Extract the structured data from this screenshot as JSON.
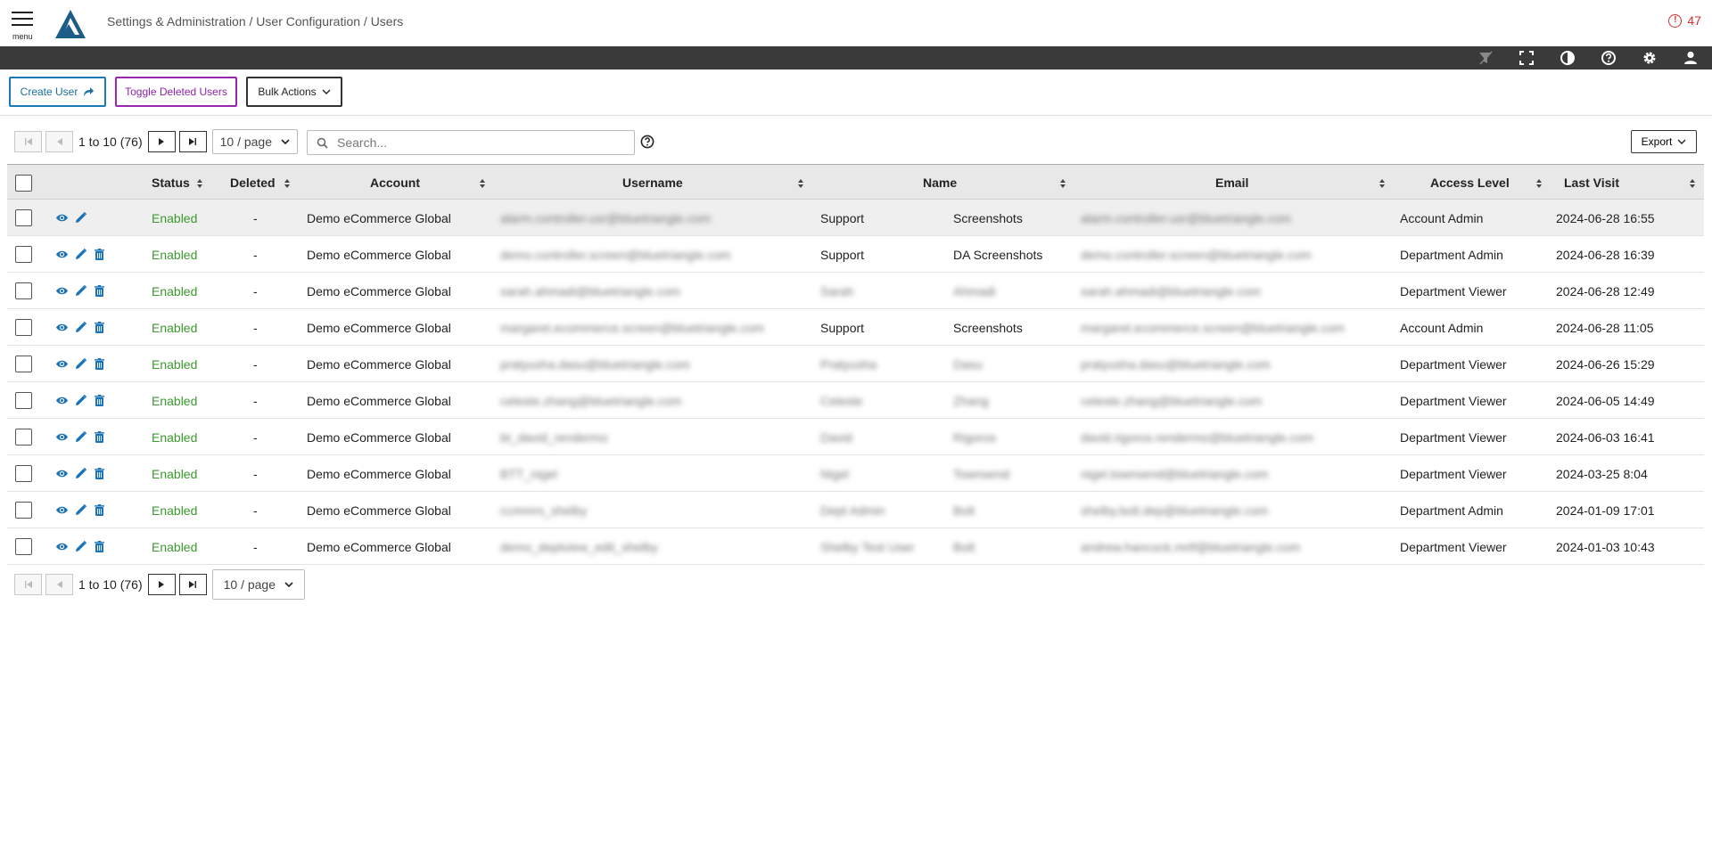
{
  "header": {
    "menu_label": "menu",
    "breadcrumb": "Settings & Administration / User Configuration / Users",
    "alert_count": "47"
  },
  "toolbar_icons": [
    "filter-icon",
    "fullscreen-icon",
    "contrast-icon",
    "help-icon",
    "gear-icon",
    "user-icon"
  ],
  "actions": {
    "create_user": "Create User",
    "toggle_deleted": "Toggle Deleted Users",
    "bulk_actions": "Bulk Actions"
  },
  "pager": {
    "count": "1 to 10 (76)",
    "page_size": "10 / page"
  },
  "search": {
    "placeholder": "Search..."
  },
  "export_label": "Export",
  "columns": [
    "Status",
    "Deleted",
    "Account",
    "Username",
    "Name",
    "Email",
    "Access Level",
    "Last Visit"
  ],
  "rows": [
    {
      "status": "Enabled",
      "deleted": "-",
      "account": "Demo eCommerce Global",
      "username": "alarm.controller.usr@bluetriangle.com",
      "first": "Support",
      "last": "Screenshots",
      "email": "alarm.controller.usr@bluetriangle.com",
      "access": "Account Admin",
      "visit": "2024-06-28 16:55"
    },
    {
      "status": "Enabled",
      "deleted": "-",
      "account": "Demo eCommerce Global",
      "username": "demo.controller.screen@bluetriangle.com",
      "first": "Support",
      "last": "DA Screenshots",
      "email": "demo.controller.screen@bluetriangle.com",
      "access": "Department Admin",
      "visit": "2024-06-28 16:39"
    },
    {
      "status": "Enabled",
      "deleted": "-",
      "account": "Demo eCommerce Global",
      "username": "sarah.ahmadi@bluetriangle.com",
      "first": "Sarah",
      "last": "Ahmadi",
      "email": "sarah.ahmadi@bluetriangle.com",
      "access": "Department Viewer",
      "visit": "2024-06-28 12:49"
    },
    {
      "status": "Enabled",
      "deleted": "-",
      "account": "Demo eCommerce Global",
      "username": "margaret.ecommerce.screen@bluetriangle.com",
      "first": "Support",
      "last": "Screenshots",
      "email": "margaret.ecommerce.screen@bluetriangle.com",
      "access": "Account Admin",
      "visit": "2024-06-28 11:05"
    },
    {
      "status": "Enabled",
      "deleted": "-",
      "account": "Demo eCommerce Global",
      "username": "pratyusha.dasu@bluetriangle.com",
      "first": "Pratyusha",
      "last": "Dasu",
      "email": "pratyusha.dasu@bluetriangle.com",
      "access": "Department Viewer",
      "visit": "2024-06-26 15:29"
    },
    {
      "status": "Enabled",
      "deleted": "-",
      "account": "Demo eCommerce Global",
      "username": "celeste.zhang@bluetriangle.com",
      "first": "Celeste",
      "last": "Zhang",
      "email": "celeste.zhang@bluetriangle.com",
      "access": "Department Viewer",
      "visit": "2024-06-05 14:49"
    },
    {
      "status": "Enabled",
      "deleted": "-",
      "account": "Demo eCommerce Global",
      "username": "bt_david_rendermo",
      "first": "David",
      "last": "Rigoros",
      "email": "david.rigoros.rendermo@bluetriangle.com",
      "access": "Department Viewer",
      "visit": "2024-06-03 16:41"
    },
    {
      "status": "Enabled",
      "deleted": "-",
      "account": "Demo eCommerce Global",
      "username": "BTT_nigel",
      "first": "Nigel",
      "last": "Townsend",
      "email": "nigel.townsend@bluetriangle.com",
      "access": "Department Viewer",
      "visit": "2024-03-25 8:04"
    },
    {
      "status": "Enabled",
      "deleted": "-",
      "account": "Demo eCommerce Global",
      "username": "ccmmrs_shelby",
      "first": "Dept Admin",
      "last": "Bolt",
      "email": "shelby.bolt.dep@bluetriangle.com",
      "access": "Department Admin",
      "visit": "2024-01-09 17:01"
    },
    {
      "status": "Enabled",
      "deleted": "-",
      "account": "Demo eCommerce Global",
      "username": "demo_deptview_edit_shelby",
      "first": "Shelby Test User",
      "last": "Bolt",
      "email": "andrew.hancock.mrtf@bluetriangle.com",
      "access": "Department Viewer",
      "visit": "2024-01-03 10:43"
    }
  ]
}
